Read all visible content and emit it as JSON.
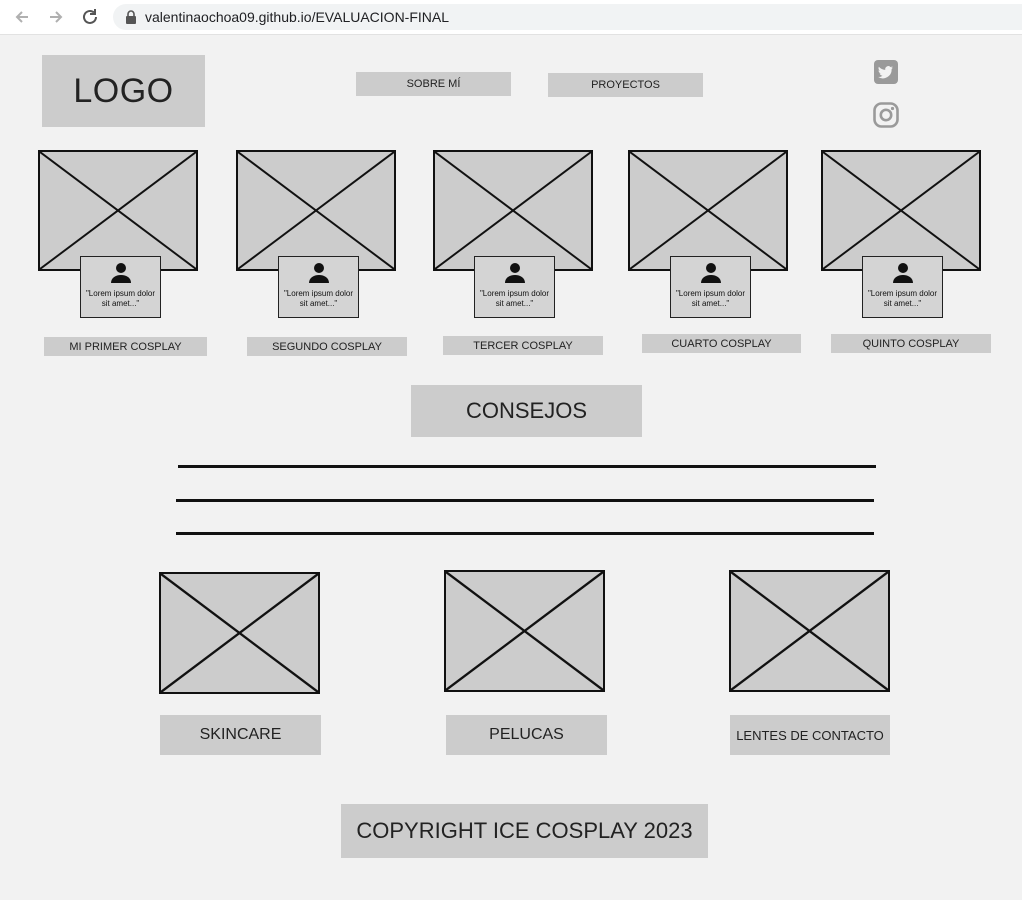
{
  "browser": {
    "url_domain": "valentinaochoa09.github.io",
    "url_path": "/EVALUACION-FINAL"
  },
  "header": {
    "logo_text": "LOGO",
    "nav": [
      {
        "label": "SOBRE MÍ"
      },
      {
        "label": "PROYECTOS"
      }
    ],
    "social_icons": [
      "twitter-icon",
      "instagram-icon"
    ]
  },
  "gallery": {
    "quote_text": "\"Lorem ipsum dolor sit amet...\"",
    "items": [
      {
        "label": "MI PRIMER COSPLAY"
      },
      {
        "label": "SEGUNDO COSPLAY"
      },
      {
        "label": "TERCER COSPLAY"
      },
      {
        "label": "CUARTO COSPLAY"
      },
      {
        "label": "QUINTO COSPLAY"
      }
    ]
  },
  "consejos": {
    "title": "CONSEJOS",
    "items": [
      {
        "label": "SKINCARE"
      },
      {
        "label": "PELUCAS"
      },
      {
        "label": "LENTES DE CONTACTO"
      }
    ]
  },
  "footer": {
    "copyright": "COPYRIGHT ICE COSPLAY 2023"
  },
  "colors": {
    "background": "#f2f2f2",
    "placeholder": "#cccccc",
    "stroke": "#111111"
  }
}
